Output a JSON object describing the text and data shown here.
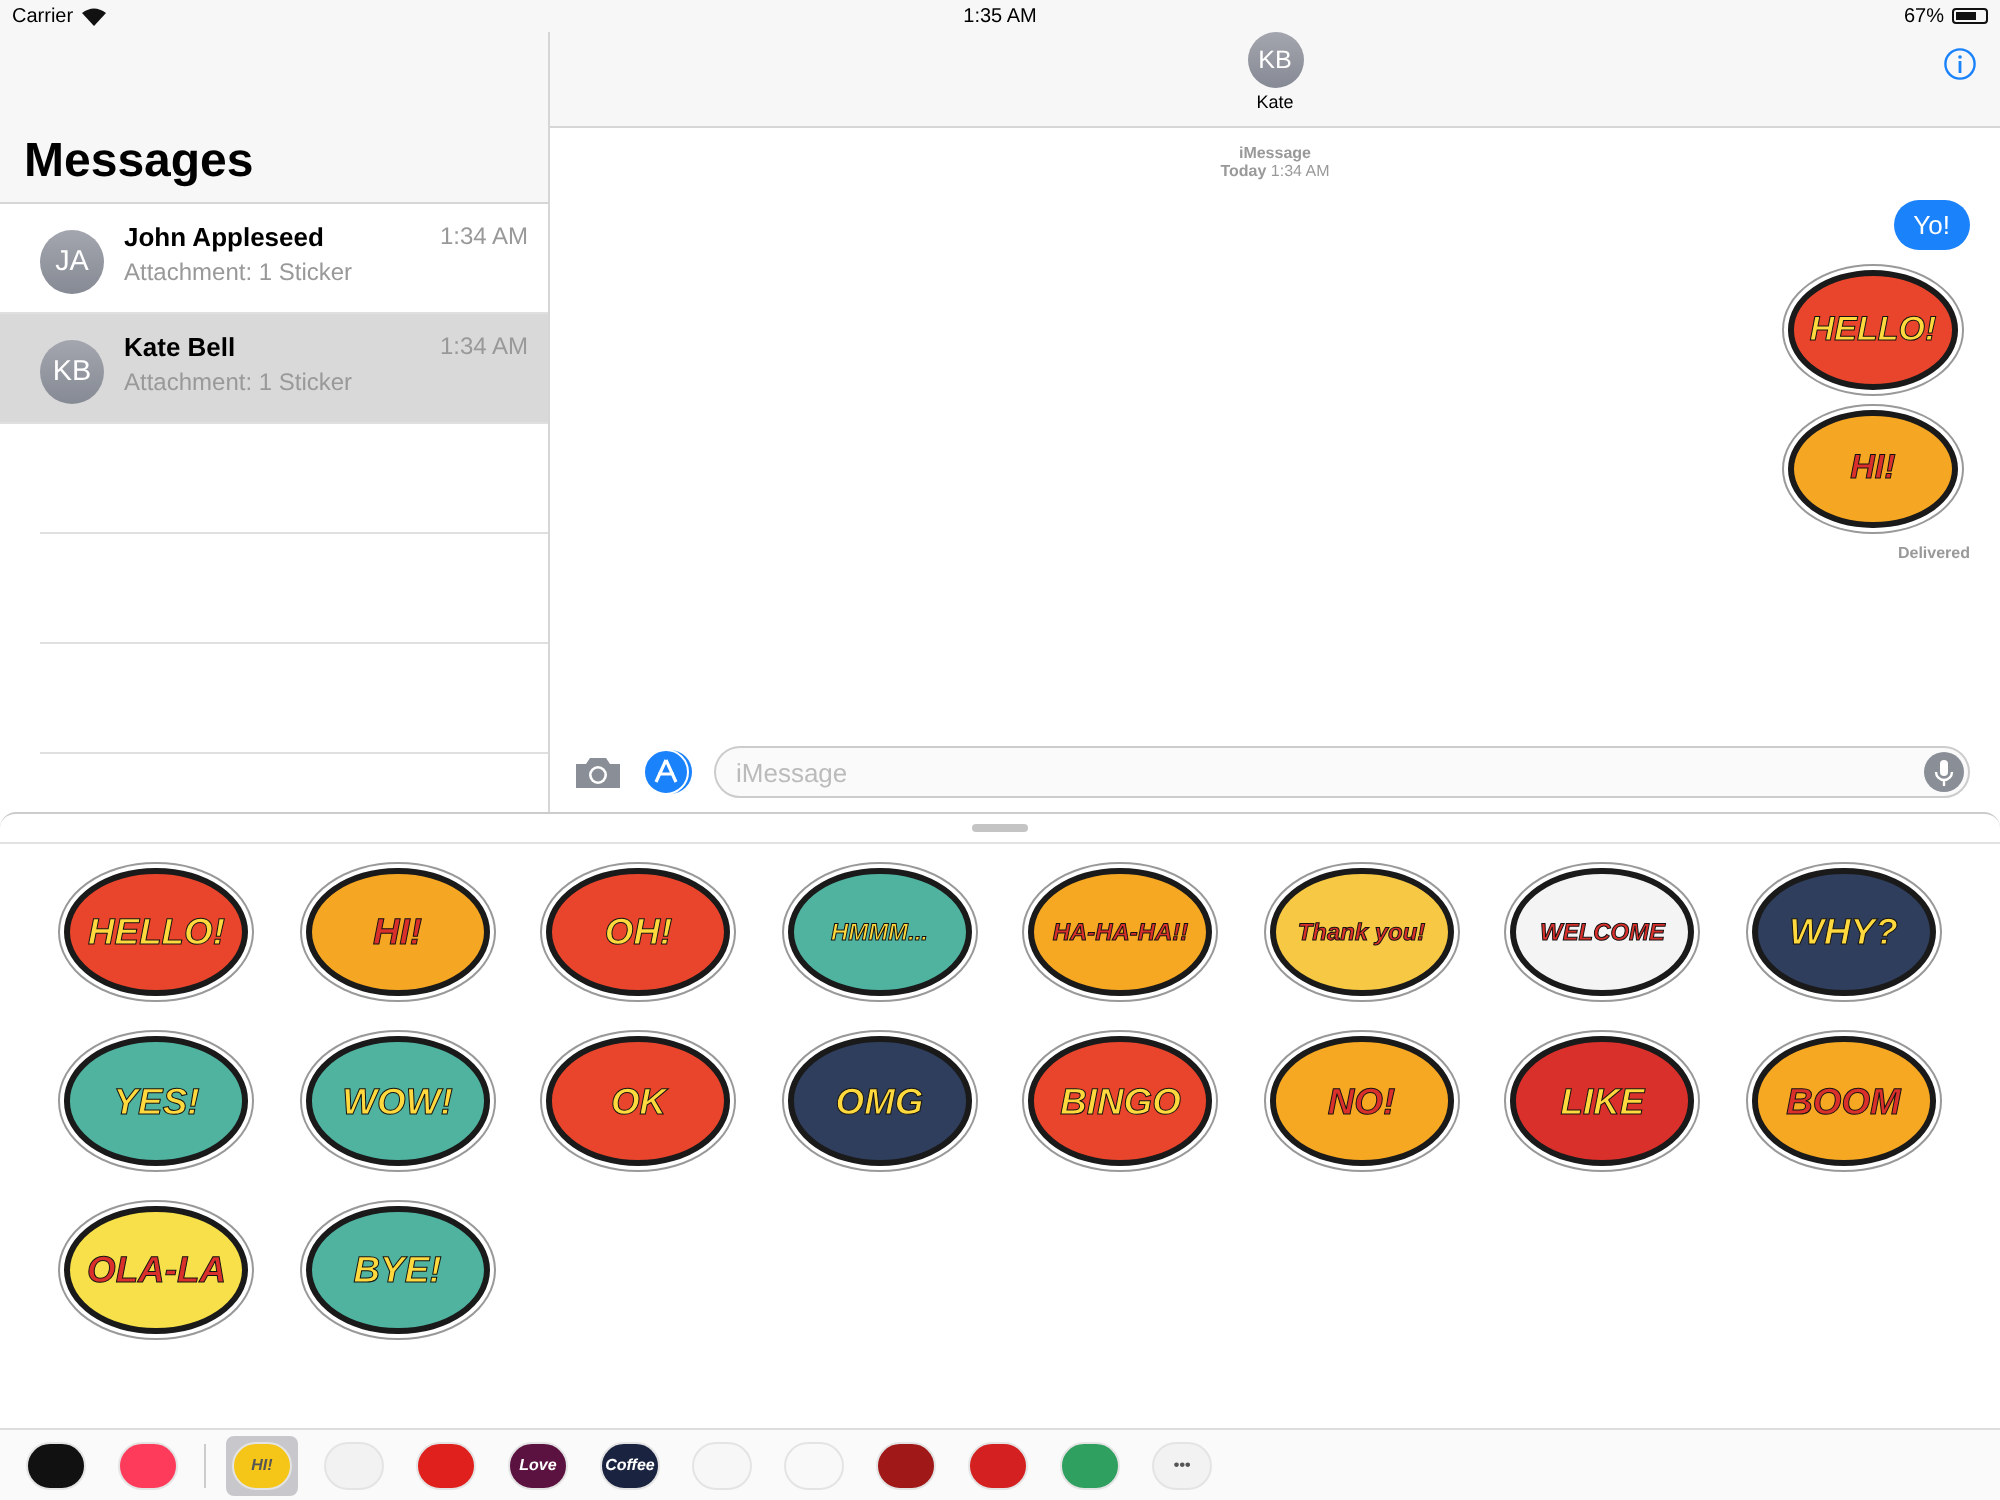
{
  "status_bar": {
    "carrier": "Carrier",
    "time": "1:35 AM",
    "battery": "67%"
  },
  "sidebar": {
    "title": "Messages",
    "conversations": [
      {
        "initials": "JA",
        "name": "John Appleseed",
        "preview": "Attachment: 1 Sticker",
        "time": "1:34 AM",
        "selected": false
      },
      {
        "initials": "KB",
        "name": "Kate Bell",
        "preview": "Attachment: 1 Sticker",
        "time": "1:34 AM",
        "selected": true
      }
    ]
  },
  "chat": {
    "contact_initials": "KB",
    "contact_name": "Kate",
    "service": "iMessage",
    "date": "Today",
    "date_time": "1:34 AM",
    "messages": [
      {
        "kind": "text",
        "text": "Yo!"
      },
      {
        "kind": "sticker",
        "text": "HELLO!",
        "color": "#e8452c"
      },
      {
        "kind": "sticker",
        "text": "HI!",
        "color": "#f5a623"
      }
    ],
    "status": "Delivered",
    "input": {
      "placeholder": "iMessage"
    }
  },
  "sticker_drawer": {
    "stickers": [
      {
        "text": "HELLO!",
        "color": "#e8452c"
      },
      {
        "text": "HI!",
        "color": "#f5a623"
      },
      {
        "text": "OH!",
        "color": "#e8452c"
      },
      {
        "text": "HMMM...",
        "color": "#4fb3a0"
      },
      {
        "text": "HA-HA-HA!!",
        "color": "#f7a823"
      },
      {
        "text": "Thank you!",
        "color": "#f7c844"
      },
      {
        "text": "WELCOME",
        "color": "#f4f4f4"
      },
      {
        "text": "WHY?",
        "color": "#2f3e5c"
      },
      {
        "text": "YES!",
        "color": "#4fb3a0"
      },
      {
        "text": "WOW!",
        "color": "#4fb3a0"
      },
      {
        "text": "OK",
        "color": "#e8452c"
      },
      {
        "text": "OMG",
        "color": "#2f3e5c"
      },
      {
        "text": "BINGO",
        "color": "#e8452c"
      },
      {
        "text": "NO!",
        "color": "#f7a823"
      },
      {
        "text": "LIKE",
        "color": "#d9302b"
      },
      {
        "text": "BOOM",
        "color": "#f7a823"
      },
      {
        "text": "OLA-LA",
        "color": "#f7e04a"
      },
      {
        "text": "BYE!",
        "color": "#4fb3a0"
      }
    ],
    "apps": [
      {
        "color": "#111111",
        "selected": false
      },
      {
        "color": "#ff3b5c",
        "selected": false
      },
      {
        "color": "#f5c518",
        "label": "HI!",
        "selected": true
      },
      {
        "color": "#f2f2f2",
        "selected": false
      },
      {
        "color": "#e0201d",
        "selected": false
      },
      {
        "color": "#5c1240",
        "label": "Love",
        "selected": false
      },
      {
        "color": "#1a2340",
        "label": "Coffee",
        "selected": false
      },
      {
        "color": "#f7f7f7",
        "selected": false
      },
      {
        "color": "#f9f9f9",
        "selected": false
      },
      {
        "color": "#a01818",
        "selected": false
      },
      {
        "color": "#d42020",
        "selected": false
      },
      {
        "color": "#2fa060",
        "selected": false
      },
      {
        "color": "#f2f2f2",
        "label": "•••",
        "selected": false
      }
    ]
  }
}
